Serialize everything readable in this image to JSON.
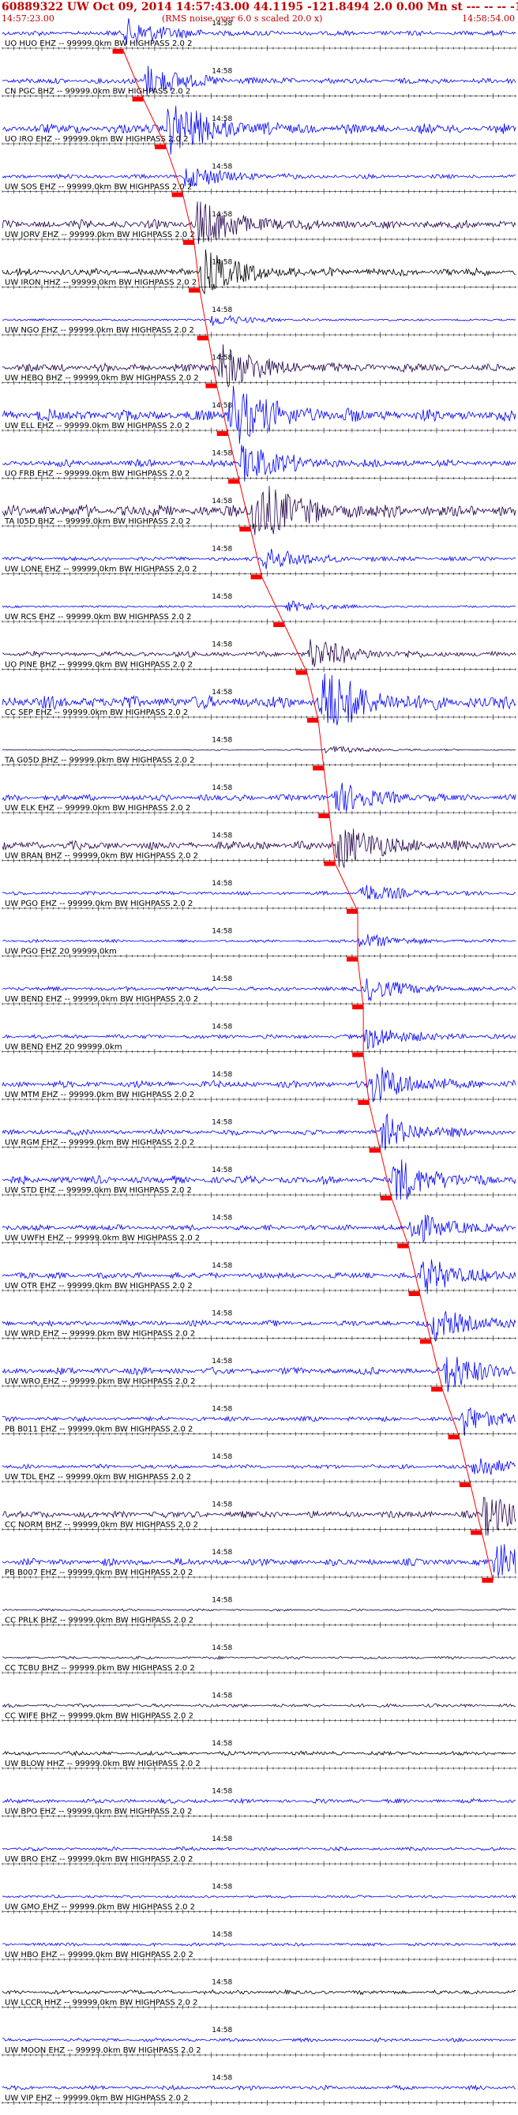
{
  "header": {
    "title": "60889322 UW Oct 09, 2014 14:57:43.00   44.1195 -121.8494  2.0 0.00 Mn st --- -- --  -1",
    "start_time": "14:57:23.00",
    "end_time": "14:58:54.00",
    "noise_note": "(RMS noise over 6.0 s scaled 20.0 x)"
  },
  "colors": {
    "text": "#000000",
    "header": "#c00000",
    "pick": "#ff0000",
    "trace_blue": "#0000ff",
    "trace_dark": "#22004a",
    "trace_black": "#000000"
  },
  "chart_data": {
    "type": "line",
    "title": "60889322 UW Oct 09, 2014 14:57:43.00   44.1195 -121.8494  2.0 0.00 Mn st --- -- --  -1",
    "x_range": [
      "14:57:23.00",
      "14:58:54.00"
    ],
    "tick_time_label": "14:58",
    "tick_time_value": "14:58:00",
    "series": [
      {
        "label": "UO HUO EHZ -- 99999.0km BW  HIGHPASS  2.0  2",
        "pick": "14:57:44.5",
        "color": "#0000ff",
        "amplitude": 0.35
      },
      {
        "label": "CN PGC BHZ -- 99999.0km BW  HIGHPASS  2.0  2",
        "pick": "14:57:48.0",
        "color": "#0000ff",
        "amplitude": 0.4
      },
      {
        "label": "UO IRO EHZ -- 99999.0km BW  HIGHPASS  2.0  2",
        "pick": "14:57:52.0",
        "color": "#0000ff",
        "amplitude": 0.7
      },
      {
        "label": "UW SOS EHZ -- 99999.0km BW  HIGHPASS  2.0  2",
        "pick": "14:57:55.0",
        "color": "#0000ff",
        "amplitude": 0.3
      },
      {
        "label": "UW JORV EHZ -- 99999.0km BW  HIGHPASS  2.0  2",
        "pick": "14:57:57.0",
        "color": "#22004a",
        "amplitude": 0.6
      },
      {
        "label": "UW IRON HHZ -- 99999.0km BW  HIGHPASS  2.0  2",
        "pick": "14:57:58.0",
        "color": "#000000",
        "amplitude": 0.55
      },
      {
        "label": "UW NGO EHZ -- 99999.0km BW  HIGHPASS  2.0  2",
        "pick": "14:57:59.5",
        "color": "#0000ff",
        "amplitude": 0.15
      },
      {
        "label": "UW HEBO BHZ -- 99999.0km BW  HIGHPASS  2.0  2",
        "pick": "14:58:01.0",
        "color": "#22004a",
        "amplitude": 0.6
      },
      {
        "label": "UW ELL EHZ -- 99999.0km BW  HIGHPASS  2.0  2",
        "pick": "14:58:03.0",
        "color": "#0000ff",
        "amplitude": 0.8
      },
      {
        "label": "UO FRB EHZ -- 99999.0km BW  HIGHPASS  2.0  2",
        "pick": "14:58:05.0",
        "color": "#0000ff",
        "amplitude": 0.5
      },
      {
        "label": "TA I05D BHZ -- 99999.0km BW  HIGHPASS  2.0  2",
        "pick": "14:58:07.0",
        "color": "#22004a",
        "amplitude": 0.85
      },
      {
        "label": "UW LONE EHZ -- 99999.0km BW  HIGHPASS  2.0  2",
        "pick": "14:58:09.0",
        "color": "#0000ff",
        "amplitude": 0.3
      },
      {
        "label": "UW RCS EHZ -- 99999.0km BW  HIGHPASS  2.0  2",
        "pick": "14:58:13.0",
        "color": "#0000ff",
        "amplitude": 0.15
      },
      {
        "label": "UO PINE BHZ -- 99999.0km BW  HIGHPASS  2.0  2",
        "pick": "14:58:17.0",
        "color": "#22004a",
        "amplitude": 0.4
      },
      {
        "label": "CC SEP EHZ -- 99999.0km BW  HIGHPASS  2.0  2",
        "pick": "14:58:19.0",
        "color": "#0000ff",
        "amplitude": 0.9
      },
      {
        "label": "TA G05D BHZ -- 99999.0km BW  HIGHPASS  2.0  2",
        "pick": "14:58:20.0",
        "color": "#22004a",
        "amplitude": 0.1
      },
      {
        "label": "UW ELK EHZ -- 99999.0km BW  HIGHPASS  2.0  2",
        "pick": "14:58:21.0",
        "color": "#0000ff",
        "amplitude": 0.45
      },
      {
        "label": "UW BRAN BHZ -- 99999.0km BW  HIGHPASS  2.0  2",
        "pick": "14:58:22.0",
        "color": "#22004a",
        "amplitude": 0.6
      },
      {
        "label": "UW PGO EHZ -- 99999.0km BW  HIGHPASS  2.0  2",
        "pick": "14:58:26.0",
        "color": "#0000ff",
        "amplitude": 0.25
      },
      {
        "label": "UW PGO EHZ 20 99999.0km",
        "pick": "14:58:26.0",
        "color": "#0000ff",
        "amplitude": 0.2
      },
      {
        "label": "UW BEND EHZ -- 99999.0km BW  HIGHPASS  2.0  2",
        "pick": "14:58:27.0",
        "color": "#0000ff",
        "amplitude": 0.3
      },
      {
        "label": "UW BEND EHZ 20 99999.0km",
        "pick": "14:58:27.0",
        "color": "#0000ff",
        "amplitude": 0.3
      },
      {
        "label": "UW MTM EHZ -- 99999.0km BW  HIGHPASS  2.0  2",
        "pick": "14:58:28.0",
        "color": "#0000ff",
        "amplitude": 0.5
      },
      {
        "label": "UW RGM EHZ -- 99999.0km BW  HIGHPASS  2.0  2",
        "pick": "14:58:30.0",
        "color": "#0000ff",
        "amplitude": 0.4
      },
      {
        "label": "UW STD EHZ -- 99999.0km BW  HIGHPASS  2.0  2",
        "pick": "14:58:32.0",
        "color": "#0000ff",
        "amplitude": 0.55
      },
      {
        "label": "UW UWFH EHZ -- 99999.0km BW  HIGHPASS  2.0  2",
        "pick": "14:58:35.0",
        "color": "#0000ff",
        "amplitude": 0.4
      },
      {
        "label": "UW OTR EHZ -- 99999.0km BW  HIGHPASS  2.0  2",
        "pick": "14:58:37.0",
        "color": "#0000ff",
        "amplitude": 0.45
      },
      {
        "label": "UW WRD EHZ -- 99999.0km BW  HIGHPASS  2.0  2",
        "pick": "14:58:39.0",
        "color": "#0000ff",
        "amplitude": 0.4
      },
      {
        "label": "UW WRO EHZ -- 99999.0km BW  HIGHPASS  2.0  2",
        "pick": "14:58:41.0",
        "color": "#0000ff",
        "amplitude": 0.5
      },
      {
        "label": "PB B011 EHZ -- 99999.0km BW  HIGHPASS  2.0  2",
        "pick": "14:58:44.0",
        "color": "#0000ff",
        "amplitude": 0.35
      },
      {
        "label": "UW TDL EHZ -- 99999.0km BW  HIGHPASS  2.0  2",
        "pick": "14:58:46.0",
        "color": "#0000ff",
        "amplitude": 0.3
      },
      {
        "label": "CC NORM BHZ -- 99999.0km BW  HIGHPASS  2.0  2",
        "pick": "14:58:48.0",
        "color": "#22004a",
        "amplitude": 0.5
      },
      {
        "label": "PB B007 EHZ -- 99999.0km BW  HIGHPASS  2.0  2",
        "pick": "14:58:50.0",
        "color": "#0000ff",
        "amplitude": 0.5
      },
      {
        "label": "CC PRLK BHZ -- 99999.0km BW  HIGHPASS  2.0  2",
        "pick": null,
        "color": "#22004a",
        "amplitude": 0.15
      },
      {
        "label": "CC TCBU BHZ -- 99999.0km BW  HIGHPASS  2.0  2",
        "pick": null,
        "color": "#22004a",
        "amplitude": 0.2
      },
      {
        "label": "CC WIFE BHZ -- 99999.0km BW  HIGHPASS  2.0  2",
        "pick": null,
        "color": "#22004a",
        "amplitude": 0.25
      },
      {
        "label": "UW BLOW HHZ -- 99999.0km BW  HIGHPASS  2.0  2",
        "pick": null,
        "color": "#000000",
        "amplitude": 0.3
      },
      {
        "label": "UW BPO EHZ -- 99999.0km BW  HIGHPASS  2.0  2",
        "pick": null,
        "color": "#0000ff",
        "amplitude": 0.3
      },
      {
        "label": "UW BRO EHZ -- 99999.0km BW  HIGHPASS  2.0  2",
        "pick": null,
        "color": "#0000ff",
        "amplitude": 0.25
      },
      {
        "label": "UW GMO EHZ -- 99999.0km BW  HIGHPASS  2.0  2",
        "pick": null,
        "color": "#0000ff",
        "amplitude": 0.2
      },
      {
        "label": "UW HBO EHZ -- 99999.0km BW  HIGHPASS  2.0  2",
        "pick": null,
        "color": "#0000ff",
        "amplitude": 0.25
      },
      {
        "label": "UW LCCR HHZ -- 99999.0km BW  HIGHPASS  2.0  2",
        "pick": null,
        "color": "#000000",
        "amplitude": 0.3
      },
      {
        "label": "UW MOON EHZ -- 99999.0km BW  HIGHPASS  2.0  2",
        "pick": null,
        "color": "#0000ff",
        "amplitude": 0.25
      },
      {
        "label": "UW VIP EHZ -- 99999.0km BW  HIGHPASS  2.0  2",
        "pick": null,
        "color": "#0000ff",
        "amplitude": 0.3
      }
    ]
  }
}
